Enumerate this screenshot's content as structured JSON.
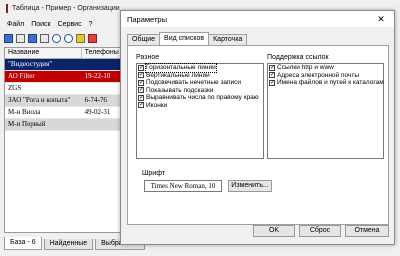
{
  "main": {
    "title": "Таблица - Пример - Организации",
    "menu": [
      "Файл",
      "Поиск",
      "Сервис"
    ],
    "menu_extra": "?",
    "grid": {
      "headers": [
        "Название",
        "Телефоны и"
      ],
      "rows": [
        {
          "name": "\"Видеостудия\"",
          "phone": ""
        },
        {
          "name": "АО Filter",
          "phone": "19-22-10"
        },
        {
          "name": "ZGS",
          "phone": ""
        },
        {
          "name": "ЗАО \"Рога и копыта\"",
          "phone": "6-74-76"
        },
        {
          "name": "М-н Виола",
          "phone": "49-02-31"
        },
        {
          "name": "М-н Первый",
          "phone": ""
        }
      ]
    },
    "bottom_tabs": [
      "База - 6",
      "Найденные",
      "Выбранные"
    ]
  },
  "dialog": {
    "title": "Параметры",
    "close": "✕",
    "tabs": [
      "Общие",
      "Вид списков",
      "Карточка"
    ],
    "active_tab": 1,
    "misc": {
      "label": "Разное",
      "items": [
        {
          "label": "Горизонтальные линии",
          "checked": true
        },
        {
          "label": "Вертикальные линии",
          "checked": true
        },
        {
          "label": "Подсвечивать нечетные записи",
          "checked": true
        },
        {
          "label": "Показывать подсказки",
          "checked": true
        },
        {
          "label": "Выравнивать числа по правому краю",
          "checked": true
        },
        {
          "label": "Иконки",
          "checked": true
        }
      ]
    },
    "links": {
      "label": "Поддержка ссылок",
      "items": [
        {
          "label": "Ссылки http и www",
          "checked": true
        },
        {
          "label": "Адреса электронной почты",
          "checked": true
        },
        {
          "label": "Имена файлов и путей к каталогам",
          "checked": true
        }
      ]
    },
    "font": {
      "label": "Шрифт",
      "value": "Times New Roman, 10",
      "change_button": "Изменить..."
    },
    "buttons": {
      "ok": "OK",
      "reset": "Сброс",
      "cancel": "Отмена"
    }
  }
}
